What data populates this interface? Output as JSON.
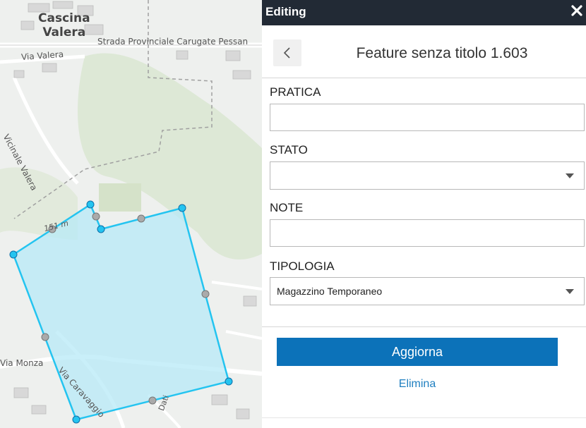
{
  "map": {
    "labels": {
      "town": "Cascina\nValera",
      "road_sp": "Strada Provinciale Carugate Pessan",
      "via_valera": "Via Valera",
      "vicinale_valera": "Vicinale Valera",
      "elevation": "151 m",
      "via_monza": "Via Monza",
      "via_caravaggio": "Via Caravaggio",
      "dati": "Dati"
    },
    "polygon_color": "#24c4f0",
    "fill_color": "#b7eaf7"
  },
  "panel": {
    "header_title": "Editing",
    "close_icon": "close-icon",
    "back_icon": "chevron-left-icon",
    "feature_title": "Feature senza titolo 1.603",
    "fields": {
      "pratica": {
        "label": "PRATICA",
        "value": ""
      },
      "stato": {
        "label": "STATO",
        "value": ""
      },
      "note": {
        "label": "NOTE",
        "value": ""
      },
      "tipologia": {
        "label": "TIPOLOGIA",
        "value": "Magazzino Temporaneo"
      }
    },
    "update_button": "Aggiorna",
    "delete_link": "Elimina",
    "colors": {
      "header_bg": "#222a35",
      "button_bg": "#0c72b9",
      "link": "#1f7fc0"
    }
  }
}
